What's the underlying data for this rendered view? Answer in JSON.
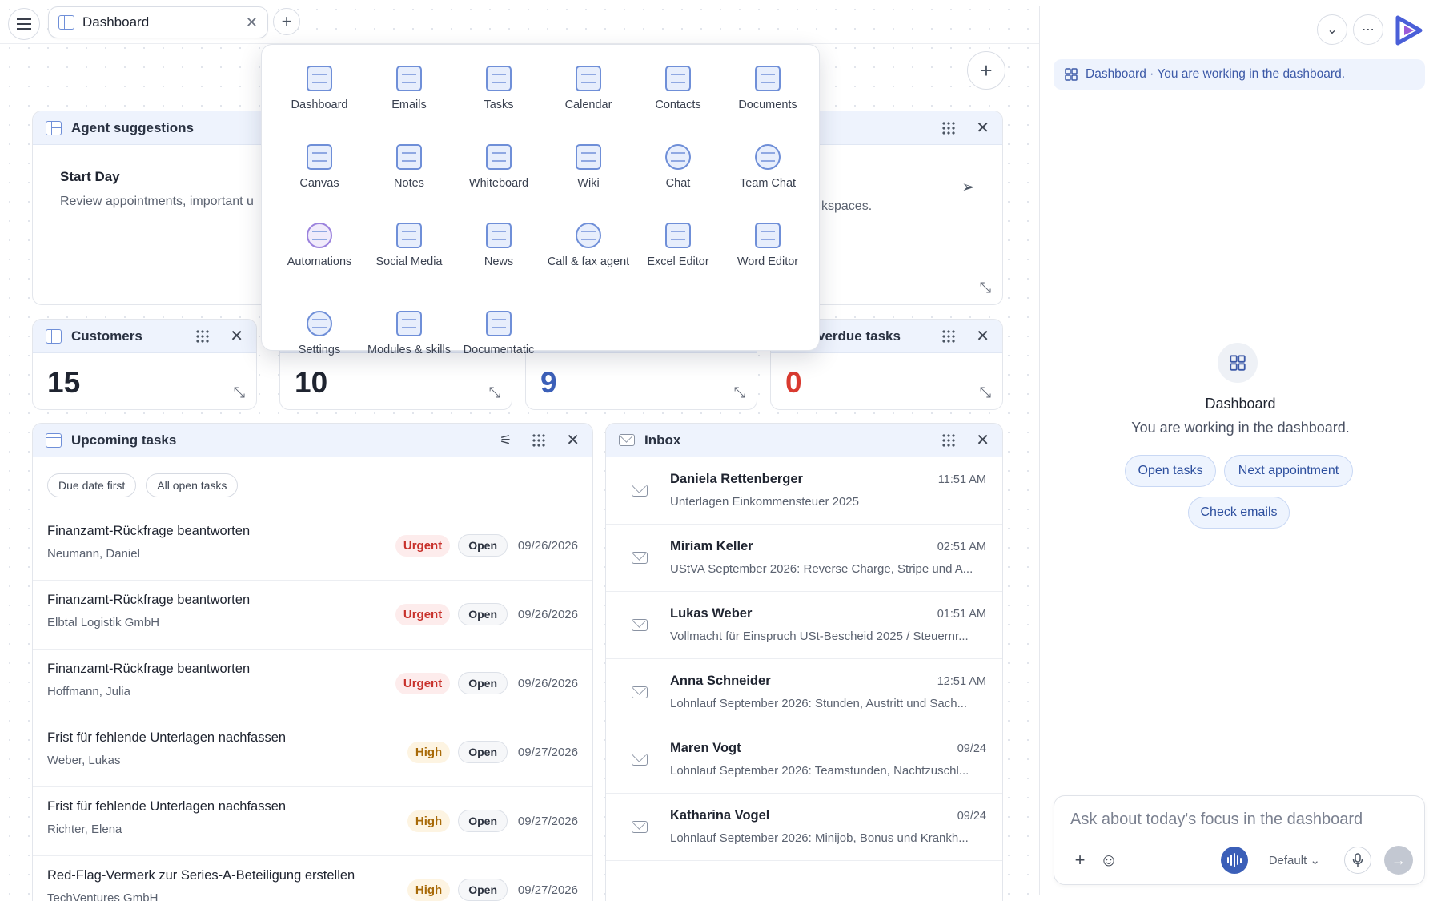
{
  "tabs": [
    {
      "label": "Dashboard"
    }
  ],
  "icons": {
    "menu": "hamburger-icon",
    "close": "close-icon",
    "add": "plus-icon",
    "drag": "drag-grip-icon",
    "expand": "expand-icon",
    "send": "send-icon"
  },
  "launcher": {
    "apps": [
      {
        "label": "Dashboard"
      },
      {
        "label": "Emails"
      },
      {
        "label": "Tasks"
      },
      {
        "label": "Calendar"
      },
      {
        "label": "Contacts"
      },
      {
        "label": "Documents"
      },
      {
        "label": "Canvas"
      },
      {
        "label": "Notes"
      },
      {
        "label": "Whiteboard"
      },
      {
        "label": "Wiki"
      },
      {
        "label": "Chat"
      },
      {
        "label": "Team Chat"
      },
      {
        "label": "Automations"
      },
      {
        "label": "Social Media"
      },
      {
        "label": "News"
      },
      {
        "label": "Call & fax agent"
      },
      {
        "label": "Excel Editor"
      },
      {
        "label": "Word Editor"
      },
      {
        "label": "Settings"
      },
      {
        "label": "Modules & skills"
      },
      {
        "label": "Documentatic"
      }
    ]
  },
  "agent": {
    "title": "Agent suggestions",
    "suggestion_title": "Start Day",
    "suggestion_text": "Review appointments, important u",
    "suggestion_tail": "kspaces."
  },
  "stats": [
    {
      "title": "Customers",
      "value": "15"
    },
    {
      "title": "",
      "value": "10"
    },
    {
      "title": "",
      "value": "9"
    },
    {
      "title": "verdue tasks",
      "value": "0"
    }
  ],
  "tasks": {
    "title": "Upcoming tasks",
    "filters": [
      "Due date first",
      "All open tasks"
    ],
    "items": [
      {
        "title": "Finanzamt-Rückfrage beantworten",
        "client": "Neumann, Daniel",
        "priority": "Urgent",
        "status": "Open",
        "due": "09/26/2026"
      },
      {
        "title": "Finanzamt-Rückfrage beantworten",
        "client": "Elbtal Logistik GmbH",
        "priority": "Urgent",
        "status": "Open",
        "due": "09/26/2026"
      },
      {
        "title": "Finanzamt-Rückfrage beantworten",
        "client": "Hoffmann, Julia",
        "priority": "Urgent",
        "status": "Open",
        "due": "09/26/2026"
      },
      {
        "title": "Frist für fehlende Unterlagen nachfassen",
        "client": "Weber, Lukas",
        "priority": "High",
        "status": "Open",
        "due": "09/27/2026"
      },
      {
        "title": "Frist für fehlende Unterlagen nachfassen",
        "client": "Richter, Elena",
        "priority": "High",
        "status": "Open",
        "due": "09/27/2026"
      },
      {
        "title": "Red-Flag-Vermerk zur Series-A-Beteiligung erstellen",
        "client": "TechVentures GmbH",
        "priority": "High",
        "status": "Open",
        "due": "09/27/2026"
      }
    ]
  },
  "inbox": {
    "title": "Inbox",
    "items": [
      {
        "from": "Daniela Rettenberger",
        "time": "11:51 AM",
        "subject": "Unterlagen Einkommensteuer 2025"
      },
      {
        "from": "Miriam Keller",
        "time": "02:51 AM",
        "subject": "UStVA September 2026: Reverse Charge, Stripe und A..."
      },
      {
        "from": "Lukas Weber",
        "time": "01:51 AM",
        "subject": "Vollmacht für Einspruch USt-Bescheid 2025 / Steuernr..."
      },
      {
        "from": "Anna Schneider",
        "time": "12:51 AM",
        "subject": "Lohnlauf September 2026: Stunden, Austritt und Sach..."
      },
      {
        "from": "Maren Vogt",
        "time": "09/24",
        "subject": "Lohnlauf September 2026: Teamstunden, Nachtzuschl..."
      },
      {
        "from": "Katharina Vogel",
        "time": "09/24",
        "subject": "Lohnlauf September 2026: Minijob, Bonus und Krankh..."
      }
    ]
  },
  "assistant": {
    "context_label": "Dashboard",
    "context_text": "· You are working in the dashboard.",
    "empty_title": "Dashboard",
    "empty_subtitle": "You are working in the dashboard.",
    "quick_actions": [
      "Open tasks",
      "Next appointment",
      "Check emails"
    ],
    "composer_placeholder": "Ask about today's focus in the dashboard",
    "model_select": "Default"
  },
  "colors": {
    "accent": "#3b5fb8",
    "urgent": "#c8312b",
    "high": "#a86a08",
    "header_bg": "#eef3fd",
    "zero_stat": "#d93a30",
    "nine_stat": "#3b5fb8"
  }
}
